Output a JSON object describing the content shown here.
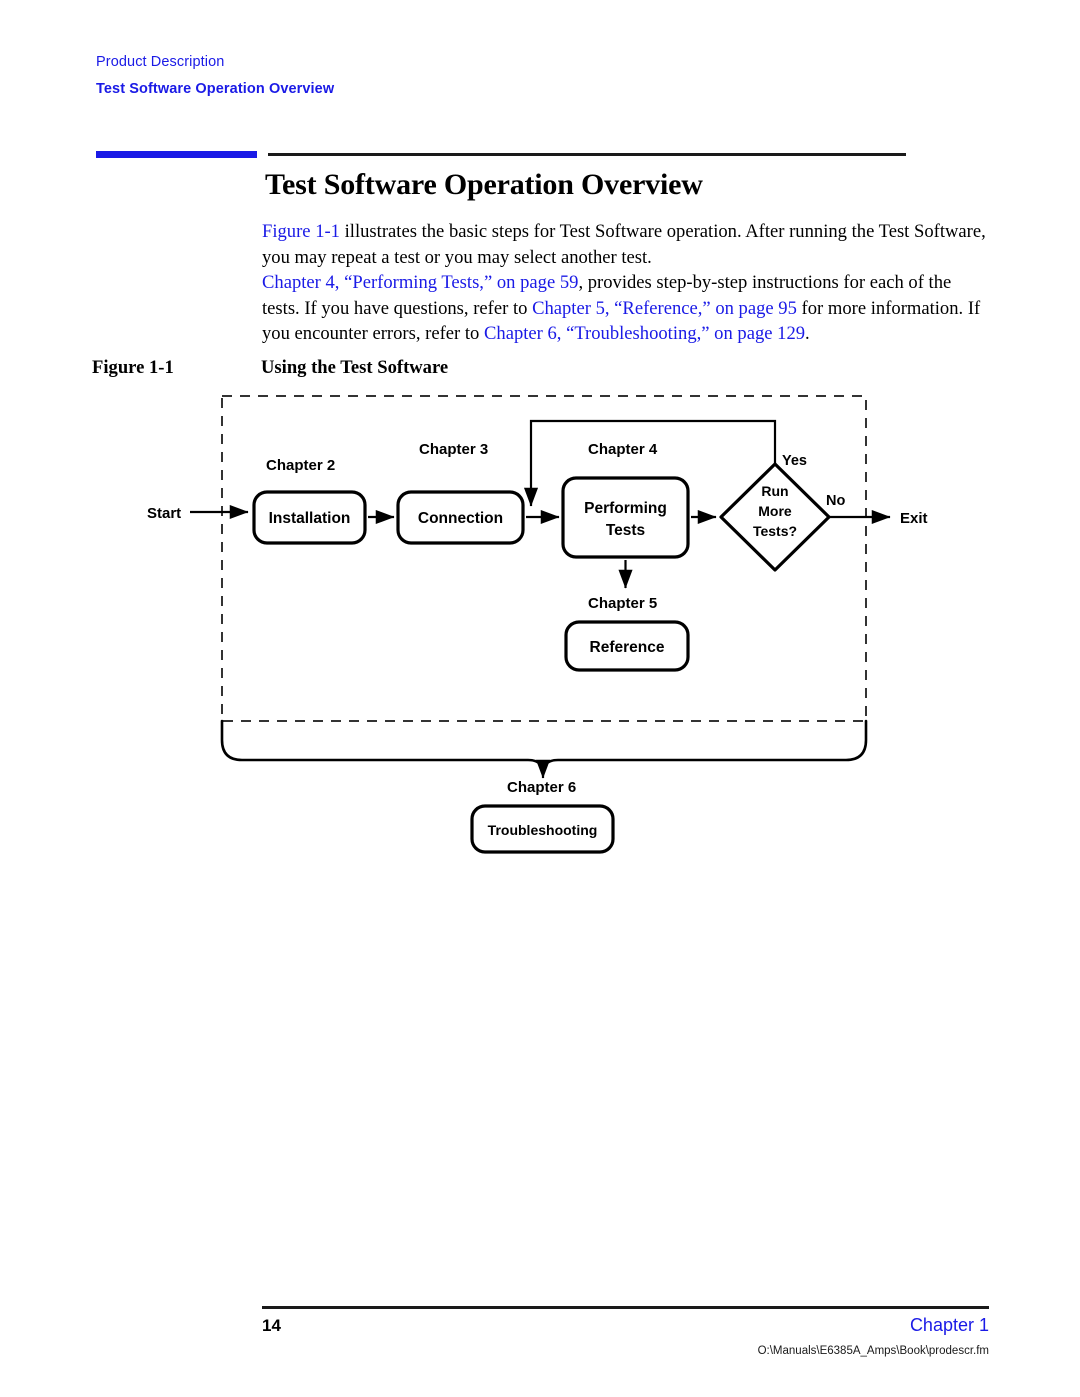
{
  "header": {
    "chapter_name": "Product Description",
    "section_name": "Test Software Operation Overview"
  },
  "section": {
    "title": "Test Software Operation Overview",
    "paragraph1": {
      "xref1": "Figure 1-1",
      "rest": " illustrates the basic steps for Test Software operation. After running the Test Software, you may repeat a test or you may select another test."
    },
    "paragraph2": {
      "xref1": "Chapter 4, “Performing Tests,” on page 59",
      "text1": ", provides step-by-step instructions for each of the tests. If you have questions, refer to ",
      "xref2": "Chapter 5, “Reference,” on page 95",
      "text2": " for more information. If you encounter errors, refer to ",
      "xref3": "Chapter 6, “Troubleshooting,” on page 129",
      "text3": "."
    }
  },
  "figure": {
    "label": "Figure 1-1",
    "title": "Using the Test Software",
    "terminals": {
      "start": "Start",
      "exit": "Exit"
    },
    "nodes": [
      {
        "id": "installation",
        "chapter": "Chapter 2",
        "label": "Installation"
      },
      {
        "id": "connection",
        "chapter": "Chapter 3",
        "label": "Connection"
      },
      {
        "id": "performing-tests",
        "chapter": "Chapter 4",
        "label_line1": "Performing",
        "label_line2": "Tests"
      },
      {
        "id": "reference",
        "chapter": "Chapter 5",
        "label": "Reference"
      },
      {
        "id": "troubleshooting",
        "chapter": "Chapter 6",
        "label": "Troubleshooting"
      }
    ],
    "decision": {
      "id": "run-more-tests",
      "line1": "Run",
      "line2": "More",
      "line3": "Tests?",
      "branch_yes": "Yes",
      "branch_no": "No"
    }
  },
  "footer": {
    "page_number": "14",
    "chapter": "Chapter 1",
    "file_path": "O:\\Manuals\\E6385A_Amps\\Book\\prodescr.fm"
  },
  "colors": {
    "link_blue": "#1a1ae6",
    "rule_black": "#1a1a1a",
    "page_background": "#ffffff"
  }
}
